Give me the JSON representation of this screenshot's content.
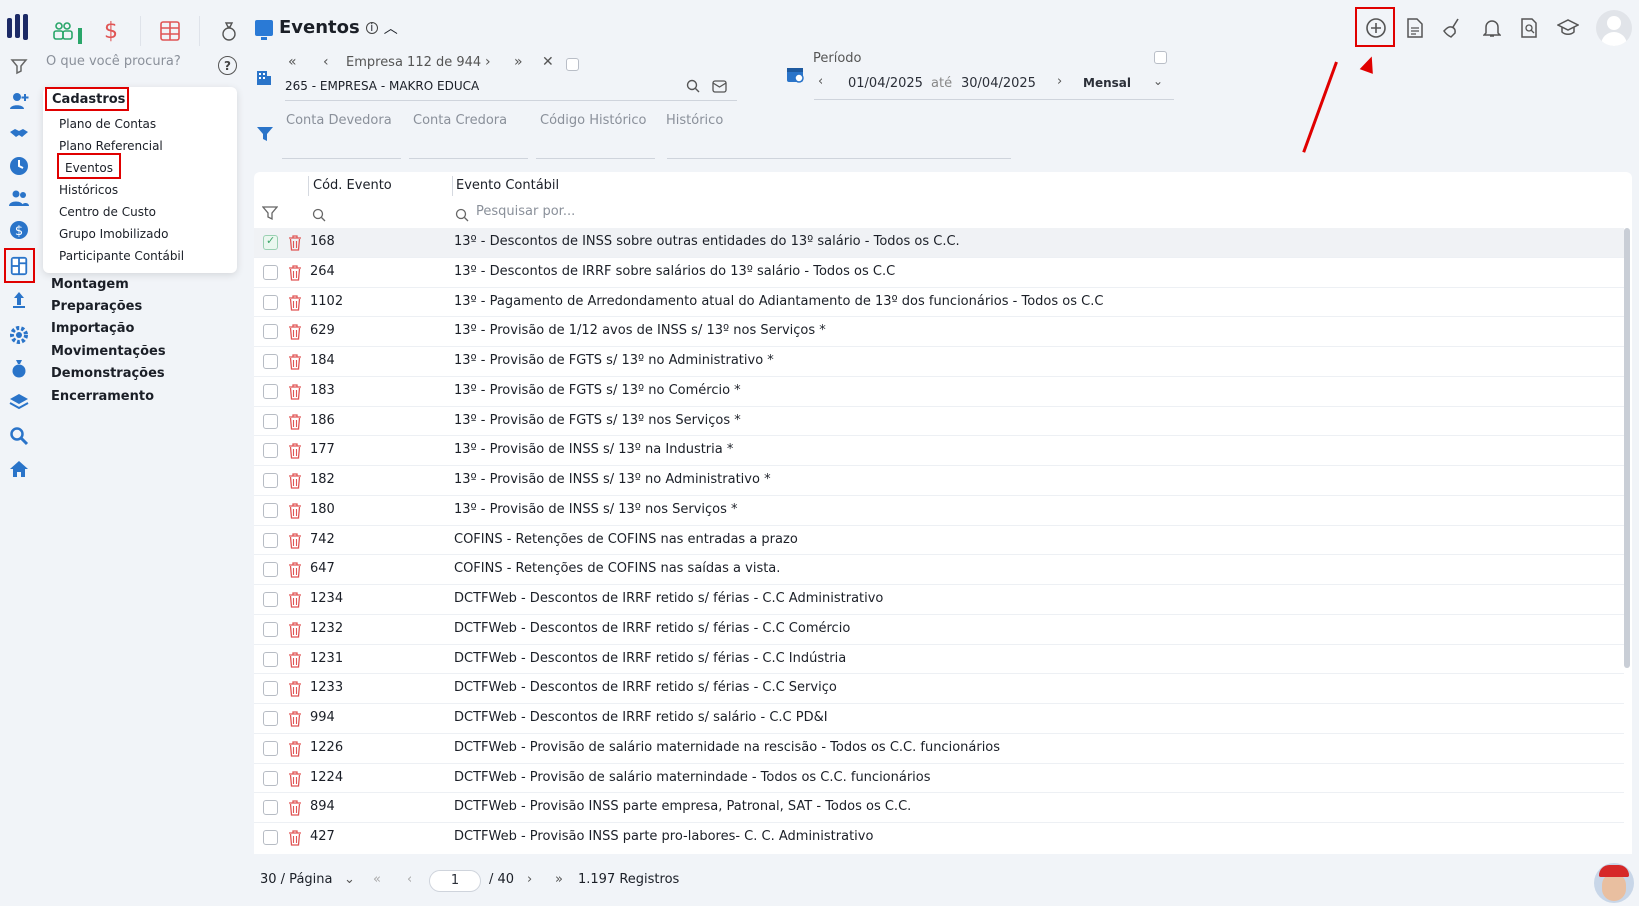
{
  "left_rail": {
    "icons": [
      "logo",
      "filter-icon",
      "person-add-icon",
      "handshake-icon",
      "clock-icon",
      "people-icon",
      "dollar-icon",
      "calculator-icon",
      "upload-icon",
      "gear-network-icon",
      "money-bag-icon",
      "layers-icon",
      "search-icon",
      "home-icon"
    ]
  },
  "modules": [
    "people-group-icon",
    "dollar-icon",
    "grid-icon",
    "money-bag-icon"
  ],
  "search": {
    "placeholder": "O que você procura?"
  },
  "menu": {
    "heading": "Cadastros",
    "items": [
      "Plano de Contas",
      "Plano Referencial",
      "Eventos",
      "Históricos",
      "Centro de Custo",
      "Grupo Imobilizado",
      "Participante Contábil"
    ],
    "sections": [
      "Montagem",
      "Preparações",
      "Importação",
      "Movimentações",
      "Demonstrações",
      "Encerramento"
    ]
  },
  "page": {
    "title": "Eventos"
  },
  "toolbar": {
    "icons": [
      "add-circle-icon",
      "document-icon",
      "broom-icon",
      "bell-icon",
      "report-search-icon",
      "graduation-cap-icon",
      "user-avatar"
    ]
  },
  "company_nav": {
    "first": "«",
    "prev": "‹",
    "label": "Empresa 112 de 944",
    "next": "›",
    "last": "»",
    "close": "✕",
    "selected": "265 - EMPRESA - MAKRO EDUCA"
  },
  "period": {
    "label": "Período",
    "from": "01/04/2025",
    "ate": "até",
    "to": "30/04/2025",
    "mode": "Mensal"
  },
  "filters": [
    "Conta Devedora",
    "Conta Credora",
    "Código Histórico",
    "Histórico"
  ],
  "grid": {
    "headers": {
      "cod": "Cód. Evento",
      "evento": "Evento Contábil"
    },
    "search_placeholder": "Pesquisar por...",
    "rows": [
      {
        "cod": "168",
        "evento": "13º - Descontos de INSS sobre outras entidades do 13º salário - Todos os C.C.",
        "selected": true
      },
      {
        "cod": "264",
        "evento": "13º - Descontos de IRRF sobre salários do 13º salário - Todos os C.C"
      },
      {
        "cod": "1102",
        "evento": "13º - Pagamento de Arredondamento atual do Adiantamento de 13º dos funcionários - Todos os C.C"
      },
      {
        "cod": "629",
        "evento": "13º - Provisão de 1/12 avos de INSS s/ 13º nos Serviços *"
      },
      {
        "cod": "184",
        "evento": "13º - Provisão de FGTS s/ 13º no Administrativo *"
      },
      {
        "cod": "183",
        "evento": "13º - Provisão de FGTS s/ 13º no Comércio *"
      },
      {
        "cod": "186",
        "evento": "13º - Provisão de FGTS s/ 13º nos Serviços *"
      },
      {
        "cod": "177",
        "evento": "13º - Provisão de INSS s/ 13º na Industria *"
      },
      {
        "cod": "182",
        "evento": "13º - Provisão de INSS s/ 13º no Administrativo *"
      },
      {
        "cod": "180",
        "evento": "13º - Provisão de INSS s/ 13º nos Serviços *"
      },
      {
        "cod": "742",
        "evento": "COFINS - Retenções de COFINS nas entradas a prazo"
      },
      {
        "cod": "647",
        "evento": "COFINS - Retenções de COFINS nas saídas a vista."
      },
      {
        "cod": "1234",
        "evento": "DCTFWeb - Descontos de IRRF retido s/ férias - C.C Administrativo"
      },
      {
        "cod": "1232",
        "evento": "DCTFWeb - Descontos de IRRF retido s/ férias - C.C Comércio"
      },
      {
        "cod": "1231",
        "evento": "DCTFWeb - Descontos de IRRF retido s/ férias - C.C Indústria"
      },
      {
        "cod": "1233",
        "evento": "DCTFWeb - Descontos de IRRF retido s/ férias - C.C Serviço"
      },
      {
        "cod": "994",
        "evento": "DCTFWeb - Descontos de IRRF retido s/ salário - C.C PD&I"
      },
      {
        "cod": "1226",
        "evento": "DCTFWeb - Provisão de salário maternidade na rescisão - Todos os C.C. funcionários"
      },
      {
        "cod": "1224",
        "evento": "DCTFWeb - Provisão de salário maternindade - Todos os C.C. funcionários"
      },
      {
        "cod": "894",
        "evento": "DCTFWeb - Provisão INSS parte empresa, Patronal, SAT - Todos os C.C."
      },
      {
        "cod": "427",
        "evento": "DCTFWeb - Provisão INSS parte pro-labores- C. C. Administrativo"
      }
    ]
  },
  "pagination": {
    "per_page": "30 / Página",
    "page": "1",
    "total_pages": "/ 40",
    "records": "1.197 Registros"
  },
  "colors": {
    "accent": "#2a74c9",
    "highlight": "#e00000",
    "delete": "#e05555"
  }
}
